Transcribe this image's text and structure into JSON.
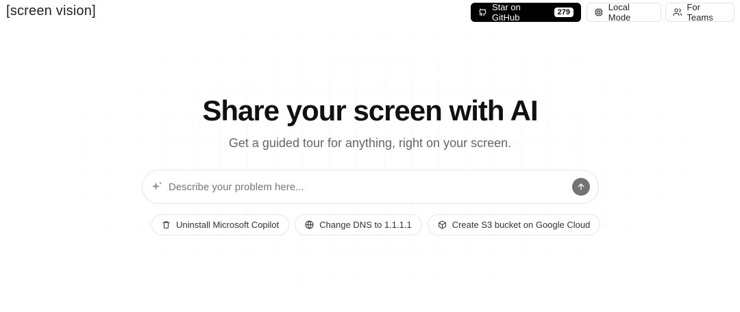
{
  "header": {
    "logo": "[screen vision]",
    "github_label": "Star on GitHub",
    "github_stars": "279",
    "local_mode": "Local Mode",
    "for_teams": "For Teams"
  },
  "hero": {
    "title": "Share your screen with AI",
    "subtitle": "Get a guided tour for anything, right on your screen."
  },
  "search": {
    "placeholder": "Describe your problem here..."
  },
  "suggestions": [
    {
      "label": "Uninstall Microsoft Copilot",
      "icon": "trash-icon"
    },
    {
      "label": "Change DNS to 1.1.1.1",
      "icon": "globe-icon"
    },
    {
      "label": "Create S3 bucket on Google Cloud",
      "icon": "box-icon"
    }
  ]
}
